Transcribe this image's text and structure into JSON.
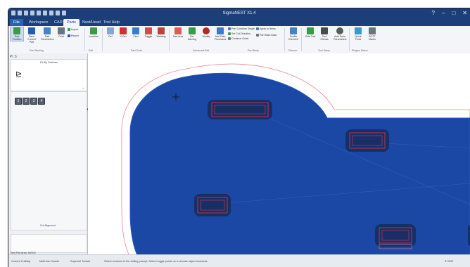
{
  "window": {
    "title": "SigmaNEST X1.4",
    "controls": [
      "?",
      "–",
      "□",
      "✕"
    ]
  },
  "menu": {
    "tabs": [
      "File",
      "Workspace",
      "CAD",
      "Parts",
      "Nest/Head",
      "Tool Help"
    ],
    "active": "Parts"
  },
  "ribbon": {
    "buttons": [
      {
        "label": "Part Position",
        "icon": "part-position-icon"
      },
      {
        "label": "Save Current Part",
        "icon": "save-icon"
      },
      {
        "label": "Part Parameters",
        "icon": "part-parameters-icon"
      },
      {
        "label": "Print",
        "icon": "print-icon"
      },
      {
        "label": "Import",
        "icon": "import-icon"
      },
      {
        "label": "Report",
        "icon": "report-icon"
      },
      {
        "label": "Location",
        "icon": "location-icon"
      },
      {
        "label": "Del",
        "icon": "delete-icon"
      },
      {
        "label": "X-Del",
        "icon": "x-delete-icon"
      },
      {
        "label": "Find",
        "icon": "find-icon"
      },
      {
        "label": "Toggle",
        "icon": "toggle-icon"
      },
      {
        "label": "Welding",
        "icon": "welding-icon"
      },
      {
        "label": "Part Arcs",
        "icon": "part-arcs-icon"
      },
      {
        "label": "Re-Naming",
        "icon": "renaming-icon"
      },
      {
        "label": "Modify",
        "icon": "modify-icon"
      },
      {
        "label": "Add Path Processes",
        "icon": "add-path-icon"
      },
      {
        "label": "Profile Element",
        "icon": "profile-element-icon"
      },
      {
        "label": "Side Tool",
        "icon": "side-tool-icon"
      },
      {
        "label": "Tool Shears",
        "icon": "tool-shears-icon"
      },
      {
        "label": "Add Tools Parameters",
        "icon": "add-tools-icon"
      },
      {
        "label": "Quick Tools",
        "icon": "quick-tools-icon"
      },
      {
        "label": "BOTT Marks",
        "icon": "bott-marks-icon"
      }
    ],
    "small_items": [
      "Part Combine Single",
      "Set Cut Direction",
      "Continue Order",
      "Apply to Items",
      "Part Main Data"
    ],
    "groups": [
      "Part Nesting",
      "Edit",
      "Part Tools",
      "Advanced Edit",
      "Part Body",
      "Planner",
      "Tool Setup",
      "Plugins Macro"
    ]
  },
  "left_panel": {
    "tabs": "Pr  S",
    "header": "Pk By Outlines",
    "glyph": "⊵",
    "buttons": [
      "1",
      "2",
      "3",
      "4"
    ],
    "link": "Cut Alignment",
    "footer": "Total Part Area: 46/100"
  },
  "status_bar": {
    "items": [
      "Current CutMap",
      "Multi-line Double",
      "Superset Toolset",
      "Select contours in the drilling prompt. Detect toggle points on a circular object shortcuts.",
      "® 2023"
    ]
  },
  "colors": {
    "titlebar": "#1c3f7a",
    "part_fill": "#1b48a4",
    "hole_fill": "#1a2e66",
    "outline_pink": "#e8868f",
    "ribbon_bg": "#f3f5f8"
  }
}
